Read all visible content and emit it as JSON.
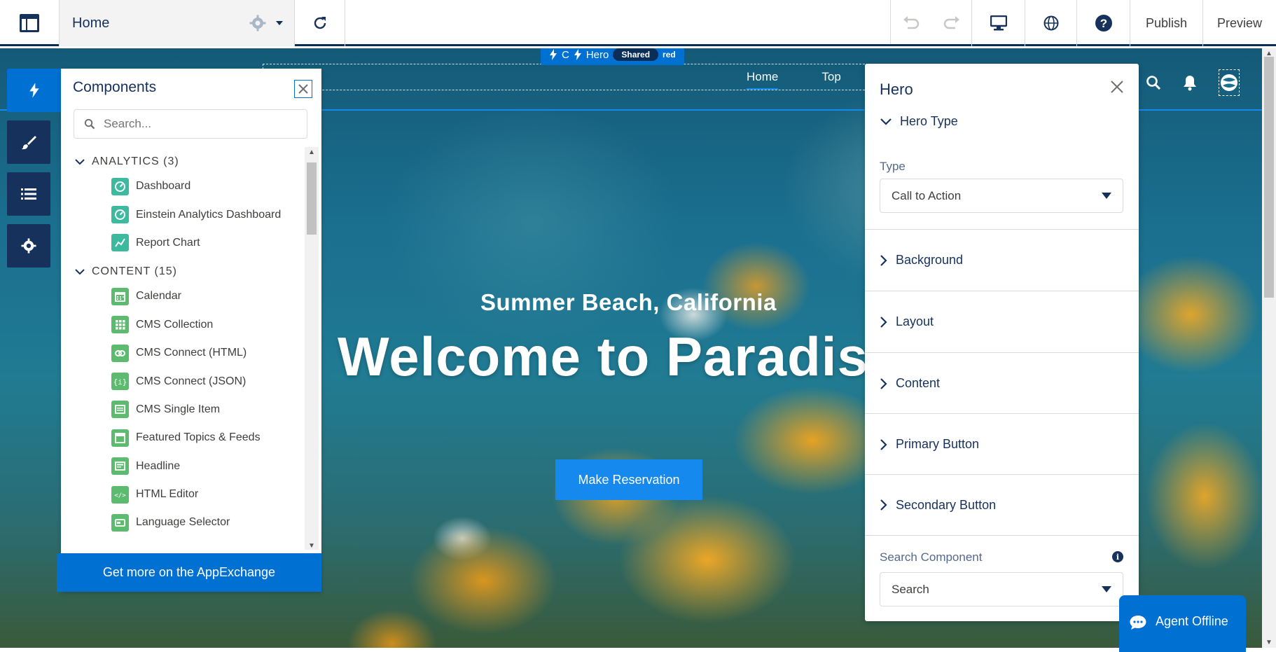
{
  "topbar": {
    "page_name": "Home",
    "publish_label": "Publish",
    "preview_label": "Preview"
  },
  "canvas": {
    "hero_label": "Hero",
    "hero_label_prefix": "C",
    "shared_badge": "Shared",
    "red_text": "red",
    "nav": [
      {
        "label": "Home"
      },
      {
        "label": "Top"
      }
    ],
    "subtitle": "Summer Beach, California",
    "title": "Welcome to Paradis",
    "cta_label": "Make Reservation"
  },
  "components_panel": {
    "title": "Components",
    "search_placeholder": "Search...",
    "categories": [
      {
        "label": "ANALYTICS (3)",
        "items": [
          {
            "label": "Dashboard",
            "icon": "dashboard-icon",
            "color": "#3bbaa0"
          },
          {
            "label": "Einstein Analytics Dashboard",
            "icon": "dashboard-icon",
            "color": "#3bbaa0"
          },
          {
            "label": "Report Chart",
            "icon": "report-chart-icon",
            "color": "#3bbaa0"
          }
        ]
      },
      {
        "label": "CONTENT (15)",
        "items": [
          {
            "label": "Calendar",
            "icon": "calendar-icon",
            "color": "#5cbb6f"
          },
          {
            "label": "CMS Collection",
            "icon": "grid-icon",
            "color": "#5cbb6f"
          },
          {
            "label": "CMS Connect (HTML)",
            "icon": "link-icon",
            "color": "#5cbb6f"
          },
          {
            "label": "CMS Connect (JSON)",
            "icon": "json-icon",
            "color": "#5cbb6f"
          },
          {
            "label": "CMS Single Item",
            "icon": "document-icon",
            "color": "#5cbb6f"
          },
          {
            "label": "Featured Topics & Feeds",
            "icon": "feed-icon",
            "color": "#5cbb6f"
          },
          {
            "label": "Headline",
            "icon": "headline-icon",
            "color": "#5cbb6f"
          },
          {
            "label": "HTML Editor",
            "icon": "code-icon",
            "color": "#5cbb6f"
          },
          {
            "label": "Language Selector",
            "icon": "language-icon",
            "color": "#5cbb6f"
          }
        ]
      }
    ],
    "appexchange_label": "Get more on the AppExchange"
  },
  "hero_panel": {
    "title": "Hero",
    "section_hero_type": "Hero Type",
    "type_label": "Type",
    "type_value": "Call to Action",
    "sections": [
      {
        "label": "Background"
      },
      {
        "label": "Layout"
      },
      {
        "label": "Content"
      },
      {
        "label": "Primary Button"
      },
      {
        "label": "Secondary Button"
      }
    ],
    "search_component_label": "Search Component",
    "search_component_value": "Search"
  },
  "agent": {
    "label": "Agent Offline"
  },
  "colors": {
    "brand": "#0070d2",
    "navy": "#16325c",
    "accent": "#1589ee"
  }
}
